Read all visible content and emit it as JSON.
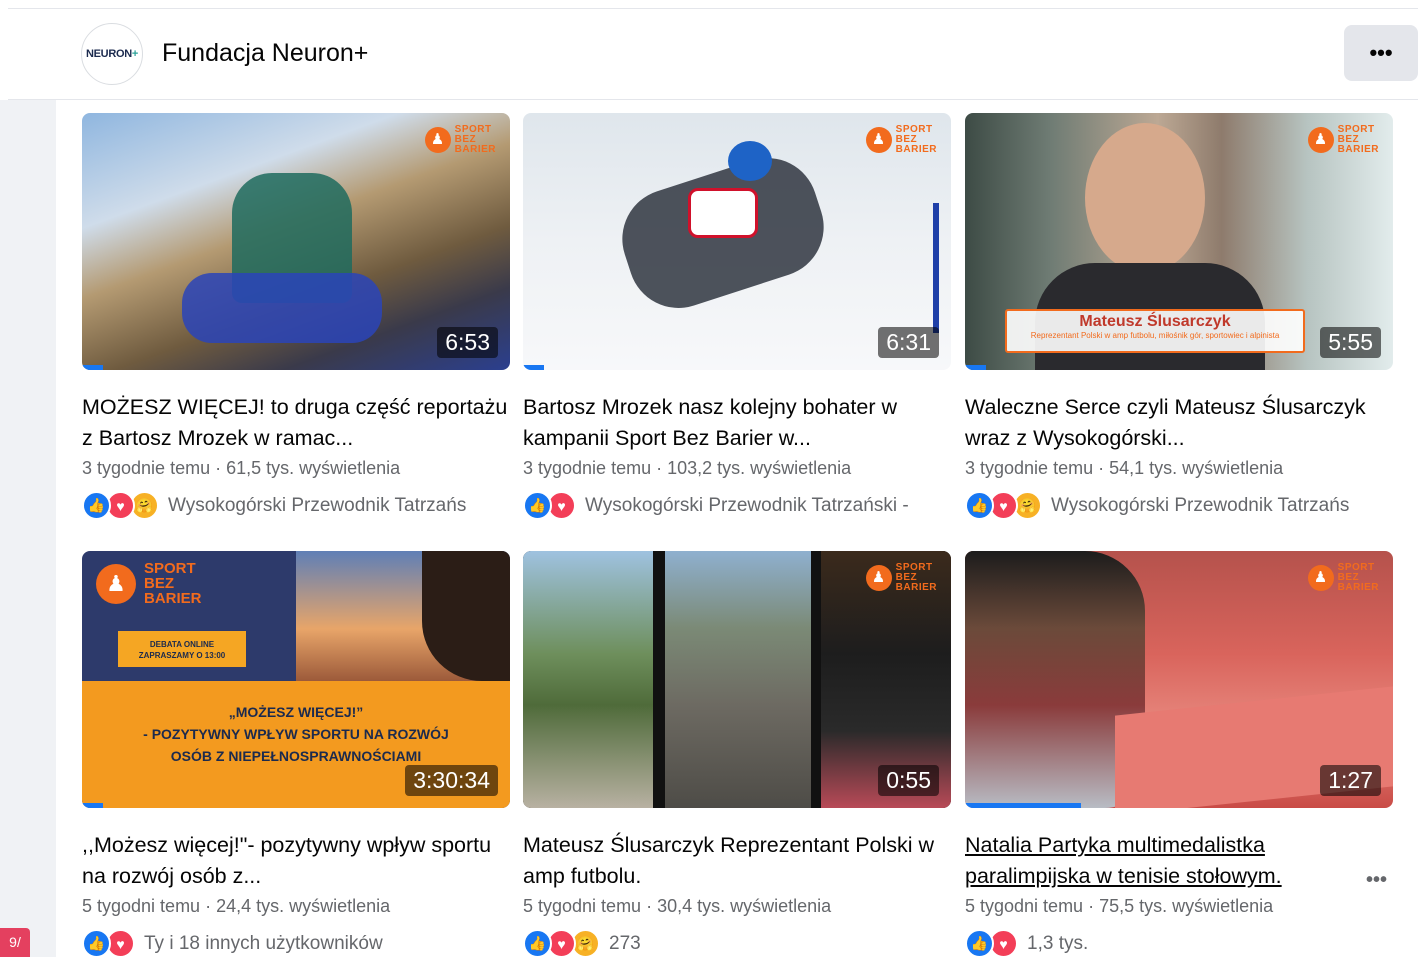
{
  "header": {
    "logo_text": "NEURON",
    "logo_plus": "+",
    "page_name": "Fundacja Neuron+",
    "more_label": "•••"
  },
  "left_badge": "9/",
  "brand_badge": {
    "icon": "♟",
    "line1": "SPORT",
    "line2": "BEZ",
    "line3": "BARIER"
  },
  "videos": [
    {
      "duration": "6:53",
      "progress": 0.05,
      "title": "MOŻESZ WIĘCEJ! to druga część reportażu z Bartosz Mrozek w ramac...",
      "meta": "3 tygodnie temu · 61,5 tys. wyświetlenia",
      "reactions": [
        "like",
        "love",
        "care"
      ],
      "reaction_text": "Wysokogórski Przewodnik Tatrzańs"
    },
    {
      "duration": "6:31",
      "progress": 0.05,
      "title": "Bartosz Mrozek nasz kolejny bohater w kampanii Sport Bez Barier w...",
      "meta": "3 tygodnie temu · 103,2 tys. wyświetlenia",
      "reactions": [
        "like",
        "love"
      ],
      "reaction_text": "Wysokogórski Przewodnik Tatrzański -"
    },
    {
      "duration": "5:55",
      "progress": 0.05,
      "title": "Waleczne Serce czyli Mateusz Ślusarczyk wraz z Wysokogórski...",
      "meta": "3 tygodnie temu · 54,1 tys. wyświetlenia",
      "reactions": [
        "like",
        "love",
        "care"
      ],
      "reaction_text": "Wysokogórski Przewodnik Tatrzańs",
      "lower_third_name": "Mateusz Ślusarczyk",
      "lower_third_sub": "Reprezentant Polski w amp futbolu, miłośnik gór, sportowiec i alpinista"
    },
    {
      "duration": "3:30:34",
      "progress": 0.05,
      "title": ",,Możesz więcej!\"- pozytywny wpływ sportu na rozwój osób z...",
      "meta": "5 tygodni temu · 24,4 tys. wyświetlenia",
      "reactions": [
        "like",
        "love"
      ],
      "reaction_text": "Ty i 18 innych użytkowników",
      "debate_box": "DEBATA ONLINE ZAPRASZAMY O 13:00",
      "banner_line1": "„MOŻESZ WIĘCEJ!”",
      "banner_line2": "- POZYTYWNY WPŁYW SPORTU NA ROZWÓJ",
      "banner_line3": "OSÓB Z NIEPEŁNOSPRAWNOŚCIAMI"
    },
    {
      "duration": "0:55",
      "progress": 0,
      "title": "Mateusz Ślusarczyk Reprezentant Polski w amp futbolu.",
      "meta": "5 tygodni temu · 30,4 tys. wyświetlenia",
      "reactions": [
        "like",
        "love",
        "care"
      ],
      "reaction_text": "273"
    },
    {
      "duration": "1:27",
      "progress": 0.27,
      "title": "Natalia Partyka multimedalistka paralimpijska w tenisie stołowym.",
      "meta": "5 tygodni temu · 75,5 tys. wyświetlenia",
      "reactions": [
        "like",
        "love"
      ],
      "reaction_text": "1,3 tys.",
      "more_label": "•••"
    }
  ],
  "reaction_icons": {
    "like": "👍",
    "love": "♥",
    "care": "🤗"
  }
}
